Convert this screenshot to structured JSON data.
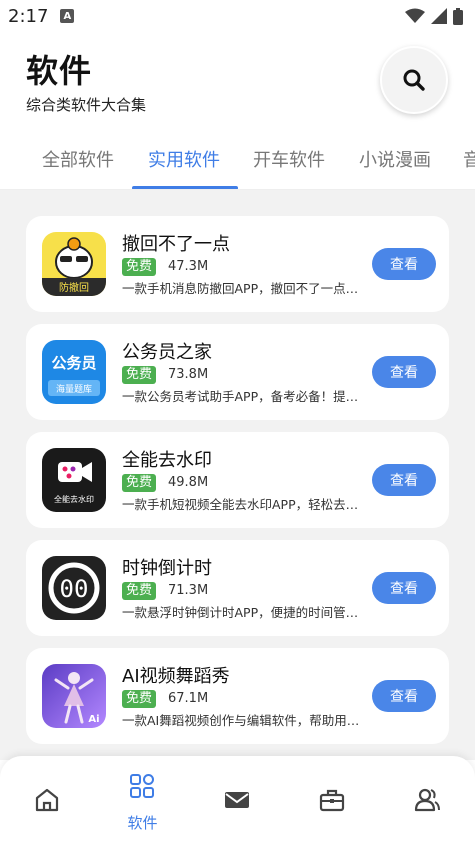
{
  "status_bar": {
    "time": "2:17",
    "notification_letter": "A"
  },
  "header": {
    "title": "软件",
    "subtitle": "综合类软件大合集"
  },
  "tabs": [
    {
      "label": "全部软件",
      "active": false
    },
    {
      "label": "实用软件",
      "active": true
    },
    {
      "label": "开车软件",
      "active": false
    },
    {
      "label": "小说漫画",
      "active": false
    },
    {
      "label": "音",
      "active": false
    }
  ],
  "apps": [
    {
      "name": "撤回不了一点",
      "badge": "免费",
      "size": "47.3M",
      "desc": "一款手机消息防撤回APP，撤回不了一点…",
      "button": "查看",
      "icon_text": "防撤回",
      "icon_name": "anti-recall-app-icon"
    },
    {
      "name": "公务员之家",
      "badge": "免费",
      "size": "73.8M",
      "desc": "一款公务员考试助手APP，备考必备！提…",
      "button": "查看",
      "icon_text": "公务员",
      "icon_subtext": "海量题库",
      "icon_name": "civil-servant-app-icon"
    },
    {
      "name": "全能去水印",
      "badge": "免费",
      "size": "49.8M",
      "desc": "一款手机短视频全能去水印APP，轻松去…",
      "button": "查看",
      "icon_text": "全能去水印",
      "icon_name": "watermark-remover-app-icon"
    },
    {
      "name": "时钟倒计时",
      "badge": "免费",
      "size": "71.3M",
      "desc": "一款悬浮时钟倒计时APP，便捷的时间管…",
      "button": "查看",
      "icon_text": "00",
      "icon_name": "countdown-clock-app-icon"
    },
    {
      "name": "AI视频舞蹈秀",
      "badge": "免费",
      "size": "67.1M",
      "desc": "一款AI舞蹈视频创作与编辑软件，帮助用…",
      "button": "查看",
      "icon_text": "Ai",
      "icon_name": "ai-dance-app-icon"
    }
  ],
  "bottom_nav": [
    {
      "icon": "home-icon",
      "label": "",
      "active": false
    },
    {
      "icon": "apps-grid-icon",
      "label": "软件",
      "active": true
    },
    {
      "icon": "mail-icon",
      "label": "",
      "active": false
    },
    {
      "icon": "toolbox-icon",
      "label": "",
      "active": false
    },
    {
      "icon": "users-icon",
      "label": "",
      "active": false
    }
  ],
  "colors": {
    "accent": "#3f7de6",
    "button": "#4a86e8",
    "badge_green": "#4caf50",
    "list_bg": "#f2f2f2"
  }
}
